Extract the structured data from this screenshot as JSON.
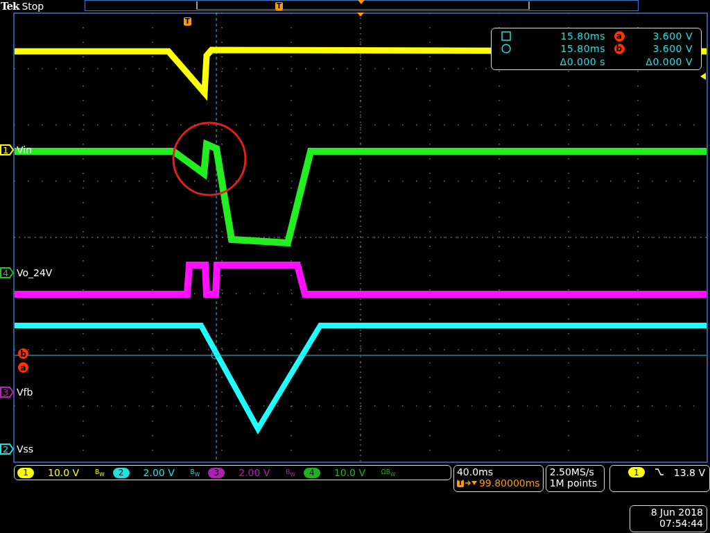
{
  "header": {
    "brand": "Tek",
    "status": "Stop",
    "record_marker": "T"
  },
  "graticule": {
    "trigger_marker": "T"
  },
  "cursor_readout": {
    "rows": [
      {
        "kind": "square",
        "time": "15.80ms",
        "badge": "a",
        "value": "3.600 V"
      },
      {
        "kind": "circle",
        "time": "15.80ms",
        "badge": "b",
        "value": "3.600 V"
      },
      {
        "kind": "delta",
        "time": "Δ0.000 s",
        "value": "Δ0.000 V"
      }
    ]
  },
  "channel_labels": [
    {
      "number": "1",
      "name": "Vin",
      "color": "#ffff00"
    },
    {
      "number": "4",
      "name": "Vo_24V",
      "color": "#20c020"
    },
    {
      "number": "3",
      "name": "Vfb",
      "color": "#c020c0"
    },
    {
      "number": "2",
      "name": "Vss",
      "color": "#20e0e0"
    }
  ],
  "cursor_markers": [
    "b",
    "a"
  ],
  "channel_settings": [
    {
      "number": "1",
      "scale": "10.0 V",
      "bandwidth": "B$_{W}$",
      "color": "#ffff00"
    },
    {
      "number": "2",
      "scale": "2.00 V",
      "bandwidth": "B$_{W}$",
      "color": "#20e0e0"
    },
    {
      "number": "3",
      "scale": "2.00 V",
      "bandwidth": "B$_{W}$",
      "color": "#b020b0"
    },
    {
      "number": "4",
      "scale": "10.0 V",
      "bandwidth": "ΩB$_{W}$",
      "color": "#20b020"
    }
  ],
  "horizontal": {
    "scale": "40.0ms",
    "trigger_marker": "T",
    "position": "99.80000ms"
  },
  "acquisition": {
    "rate": "2.50MS/s",
    "length": "1M points"
  },
  "trigger": {
    "source": "1",
    "level": "13.8 V"
  },
  "timestamp": {
    "date": "8 Jun 2018",
    "time": "07:54:44"
  }
}
